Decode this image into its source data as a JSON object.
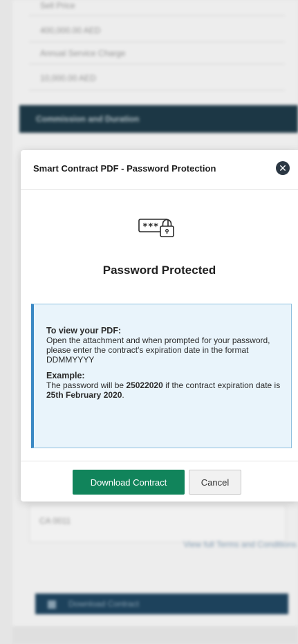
{
  "background": {
    "fields": [
      {
        "label": "Sell Price",
        "value": "400,000.00 AED"
      },
      {
        "label": "Annual Service Charge",
        "value": "10,000.00 AED"
      }
    ],
    "section_title": "Commission and Duration",
    "contract_number": "CA 0011",
    "terms_link": "View full Terms and Conditions",
    "download_button": "Download Contract"
  },
  "modal": {
    "title": "Smart Contract PDF - Password Protection",
    "close_icon": "close-icon",
    "icon": "password-lock-icon",
    "heading": "Password Protected",
    "info": {
      "view_title": "To view your PDF:",
      "view_text": "Open the attachment and when prompted for your password, please enter the contract's expiration date in the format DDMMYYYY",
      "example_title": "Example:",
      "example_prefix": "The password will be ",
      "example_password": "25022020",
      "example_middle": " if the contract expiration date is ",
      "example_date": "25th February 2020",
      "example_suffix": "."
    },
    "buttons": {
      "download": "Download Contract",
      "cancel": "Cancel"
    }
  },
  "colors": {
    "primary_button": "#11845b",
    "info_border": "#3a88c4",
    "info_background": "#e9f4fb",
    "section_header": "#1e3a48"
  }
}
